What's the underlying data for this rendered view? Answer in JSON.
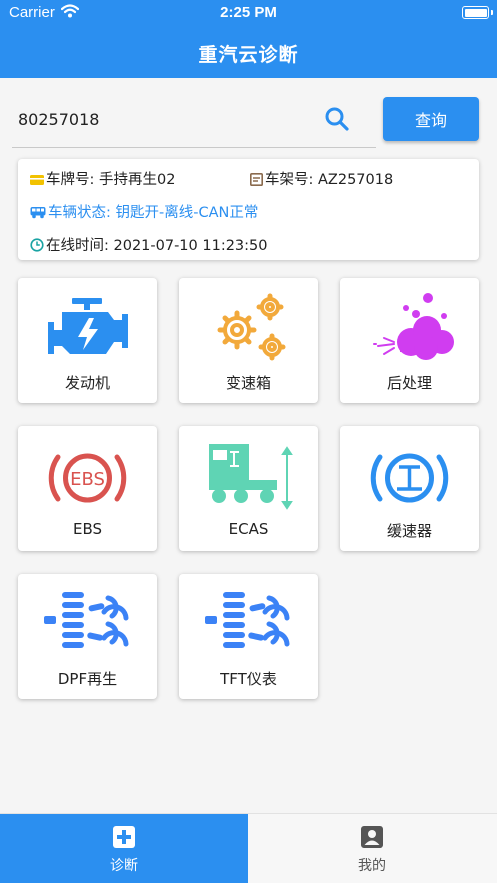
{
  "status_bar": {
    "carrier": "Carrier",
    "time": "2:25 PM"
  },
  "nav": {
    "title": "重汽云诊断"
  },
  "search": {
    "value": "80257018",
    "button_label": "查询"
  },
  "vehicle": {
    "plate_label": "车牌号: 手持再生02",
    "frame_label": "车架号: AZ257018",
    "status_label": "车辆状态: 钥匙开-离线-CAN正常",
    "online_label": "在线时间: 2021-07-10 11:23:50"
  },
  "menu": [
    {
      "label": "发动机",
      "icon": "engine-icon"
    },
    {
      "label": "变速箱",
      "icon": "gears-icon"
    },
    {
      "label": "后处理",
      "icon": "exhaust-cloud-icon"
    },
    {
      "label": "EBS",
      "icon": "ebs-brake-icon"
    },
    {
      "label": "ECAS",
      "icon": "truck-suspension-icon"
    },
    {
      "label": "缓速器",
      "icon": "retarder-icon"
    },
    {
      "label": "DPF再生",
      "icon": "dpf-icon"
    },
    {
      "label": "TFT仪表",
      "icon": "tft-dpf-icon"
    }
  ],
  "tabbar": [
    {
      "label": "诊断",
      "icon": "plus-square-icon",
      "active": true
    },
    {
      "label": "我的",
      "icon": "user-icon",
      "active": false
    }
  ],
  "colors": {
    "primary": "#2b8ff0",
    "engine": "#2b8ff0",
    "gears": "#f2a93b",
    "exhaust": "#d03df0",
    "ebs": "#d9534f",
    "ecas": "#5fd4b4",
    "retarder": "#2b8ff0",
    "dpf": "#3b82f6"
  }
}
